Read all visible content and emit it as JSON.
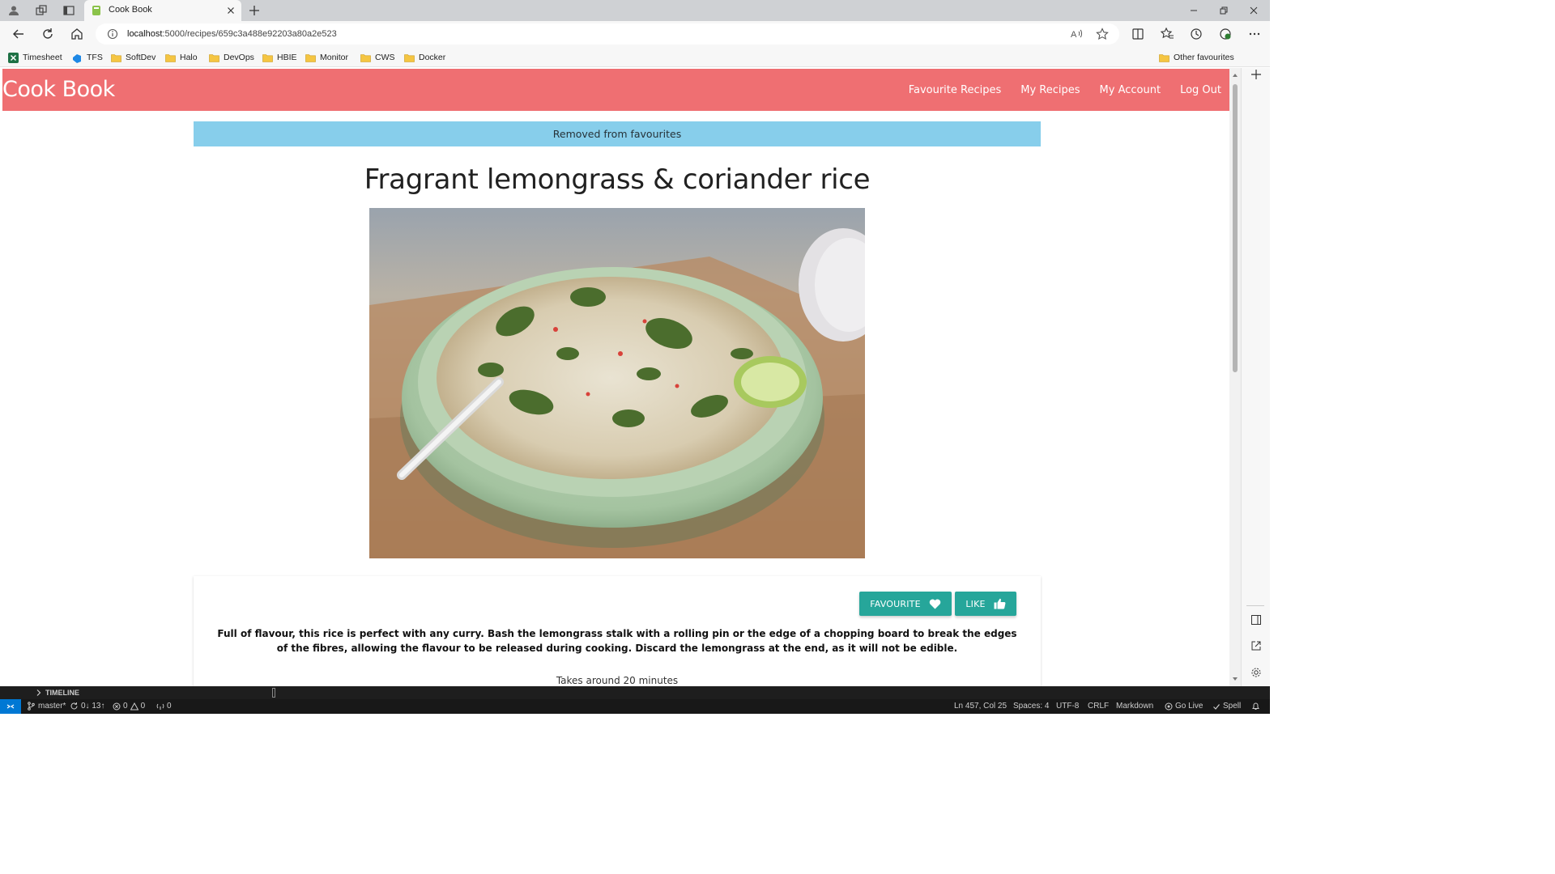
{
  "browser": {
    "tab_title": "Cook Book",
    "url_host": "localhost",
    "url_path": ":5000/recipes/659c3a488e92203a80a2e523",
    "favourites": [
      "Timesheet",
      "TFS",
      "SoftDev",
      "Halo",
      "DevOps",
      "HBIE",
      "Monitor",
      "CWS",
      "Docker"
    ],
    "other_favourites": "Other favourites"
  },
  "app": {
    "brand": "Cook Book",
    "nav": [
      "Favourite Recipes",
      "My Recipes",
      "My Account",
      "Log Out"
    ],
    "header_color": "#ef6f72"
  },
  "flash": {
    "message": "Removed from favourites",
    "color": "#87ceeb"
  },
  "recipe": {
    "title": "Fragrant lemongrass & coriander rice",
    "favourite_label": "FAVOURITE",
    "like_label": "LIKE",
    "description": "Full of flavour, this rice is perfect with any curry. Bash the lemongrass stalk with a rolling pin or the edge of a chopping board to break the edges of the fibres, allowing the flavour to be released during cooking. Discard the lemongrass at the end, as it will not be edible.",
    "takes": "Takes around 20 minutes",
    "button_color": "#26a69a"
  },
  "vscode": {
    "timeline": "TIMELINE",
    "branch": "master*",
    "sync": "0↓ 13↑",
    "errors": "0",
    "warnings": "0",
    "ports": "0",
    "position": "Ln 457, Col 25",
    "spaces": "Spaces: 4",
    "encoding": "UTF-8",
    "eol": "CRLF",
    "language": "Markdown",
    "golive": "Go Live",
    "spell": "Spell"
  }
}
